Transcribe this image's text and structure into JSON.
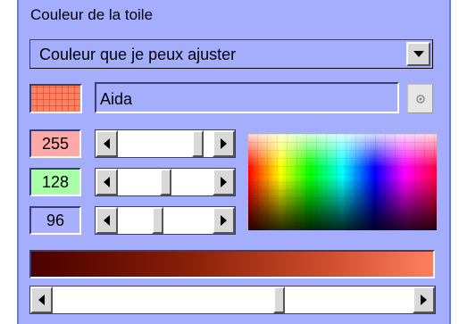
{
  "title": "Couleur de la toile",
  "color_mode_select": {
    "selected": "Couleur que je peux ajuster"
  },
  "color_name": "Aida",
  "rgb": {
    "red": {
      "value": "255",
      "bg": "#ffa8a8"
    },
    "green": {
      "value": "128",
      "bg": "#a8ffa8"
    },
    "blue": {
      "value": "96",
      "bg": "#a8b0ff"
    }
  },
  "swatch_color": "#ff8060",
  "icons": {
    "dropdown": "chevron-down-icon",
    "picker": "eyedropper-icon",
    "scroll_left": "arrow-left-icon",
    "scroll_right": "arrow-right-icon"
  }
}
